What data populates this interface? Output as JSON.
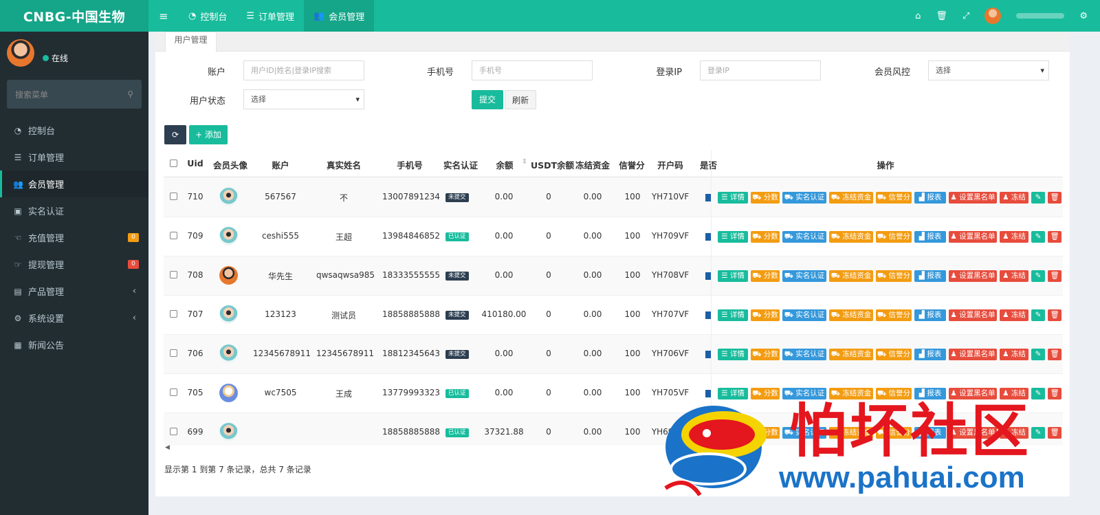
{
  "app": {
    "logo": "CNBG-中国生物"
  },
  "topnav": [
    {
      "icon": "dashboard-icon",
      "label": "控制台"
    },
    {
      "icon": "list-icon",
      "label": "订单管理"
    },
    {
      "icon": "users-icon",
      "label": "会员管理"
    }
  ],
  "sidebar": {
    "status": "在线",
    "search_placeholder": "搜索菜单",
    "items": [
      {
        "icon": "dashboard-icon",
        "label": "控制台",
        "badge": ""
      },
      {
        "icon": "list-icon",
        "label": "订单管理",
        "badge": ""
      },
      {
        "icon": "users-icon",
        "label": "会员管理",
        "badge": ""
      },
      {
        "icon": "idcard-icon",
        "label": "实名认证",
        "badge": ""
      },
      {
        "icon": "hand-icon",
        "label": "充值管理",
        "badge": "0"
      },
      {
        "icon": "hand-icon",
        "label": "提现管理",
        "badge": "0"
      },
      {
        "icon": "bag-icon",
        "label": "产品管理",
        "badge": ""
      },
      {
        "icon": "gears-icon",
        "label": "系统设置",
        "badge": ""
      },
      {
        "icon": "newspaper-icon",
        "label": "新闻公告",
        "badge": ""
      }
    ]
  },
  "tab": {
    "label": "用户管理"
  },
  "filters": {
    "account_label": "账户",
    "account_placeholder": "用户ID|姓名|登录IP搜索",
    "phone_label": "手机号",
    "phone_placeholder": "手机号",
    "ip_label": "登录IP",
    "ip_placeholder": "登录IP",
    "risk_label": "会员风控",
    "risk_value": "选择",
    "status_label": "用户状态",
    "status_value": "选择",
    "submit": "提交",
    "refresh": "刷新"
  },
  "toolbar": {
    "refresh_icon": "refresh-icon",
    "add": "+ 添加"
  },
  "table": {
    "headers": {
      "uid": "Uid",
      "avatar": "会员头像",
      "account": "账户",
      "realname": "真实姓名",
      "phone": "手机号",
      "verify": "实名认证",
      "balance": "余额",
      "usdt": "USDT余额",
      "frozen": "冻结资金",
      "credit": "信誉分",
      "code": "开户码",
      "extra": "是否",
      "ops": "操作"
    },
    "rows": [
      {
        "uid": "710",
        "avatar": "doctor",
        "account": "567567",
        "realname": "不",
        "phone": "13007891234",
        "verify": "未提交",
        "verify_ok": false,
        "balance": "0.00",
        "usdt": "0",
        "frozen": "0.00",
        "credit": "100",
        "code": "YH710VF"
      },
      {
        "uid": "709",
        "avatar": "doctor",
        "account": "ceshi555",
        "realname": "王超",
        "phone": "13984846852",
        "verify": "已认证",
        "verify_ok": true,
        "balance": "0.00",
        "usdt": "0",
        "frozen": "0.00",
        "credit": "100",
        "code": "YH709VF"
      },
      {
        "uid": "708",
        "avatar": "orange",
        "account": "华先生",
        "realname": "qwsaqwsa985",
        "phone": "18333555555",
        "verify": "未提交",
        "verify_ok": false,
        "balance": "0.00",
        "usdt": "0",
        "frozen": "0.00",
        "credit": "100",
        "code": "YH708VF"
      },
      {
        "uid": "707",
        "avatar": "doctor",
        "account": "123123",
        "realname": "测试员",
        "phone": "18858885888",
        "verify": "未提交",
        "verify_ok": false,
        "balance": "410180.00",
        "usdt": "0",
        "frozen": "0.00",
        "credit": "100",
        "code": "YH707VF"
      },
      {
        "uid": "706",
        "avatar": "doctor",
        "account": "12345678911",
        "realname": "12345678911",
        "phone": "18812345643",
        "verify": "未提交",
        "verify_ok": false,
        "balance": "0.00",
        "usdt": "0",
        "frozen": "0.00",
        "credit": "100",
        "code": "YH706VF"
      },
      {
        "uid": "705",
        "avatar": "blue",
        "account": "wc7505",
        "realname": "王成",
        "phone": "13779993323",
        "verify": "已认证",
        "verify_ok": true,
        "balance": "0.00",
        "usdt": "0",
        "frozen": "0.00",
        "credit": "100",
        "code": "YH705VF"
      },
      {
        "uid": "699",
        "avatar": "doctor",
        "account": "",
        "realname": "",
        "phone": "18858885888",
        "verify": "已认证",
        "verify_ok": true,
        "balance": "37321.88",
        "usdt": "0",
        "frozen": "0.00",
        "credit": "100",
        "code": "YH699VF"
      }
    ],
    "actions": [
      {
        "label": "详情",
        "color": "green",
        "icon": "list-icon"
      },
      {
        "label": "分数",
        "color": "orange",
        "icon": "cart-icon"
      },
      {
        "label": "实名认证",
        "color": "blue",
        "icon": "cart-icon"
      },
      {
        "label": "冻结资金",
        "color": "orange",
        "icon": "cart-icon"
      },
      {
        "label": "信誉分",
        "color": "orange",
        "icon": "cart-icon"
      },
      {
        "label": "报表",
        "color": "blue",
        "icon": "chart-icon"
      },
      {
        "label": "设置黑名单",
        "color": "red",
        "icon": "user-icon"
      },
      {
        "label": "冻结",
        "color": "red",
        "icon": "user-icon"
      },
      {
        "label": "",
        "color": "green",
        "icon": "pencil-icon"
      },
      {
        "label": "",
        "color": "red",
        "icon": "trash-icon"
      }
    ]
  },
  "pagination": {
    "summary": "显示第 1 到第 7 条记录，总共 7 条记录"
  },
  "watermark": {
    "text": "怕坏社区",
    "url": "www.pahuai.com"
  },
  "colors": {
    "primary": "#18bc9c",
    "sidebar": "#222d32",
    "orange": "#f39c12",
    "blue": "#3498db",
    "red": "#e74c3c"
  }
}
